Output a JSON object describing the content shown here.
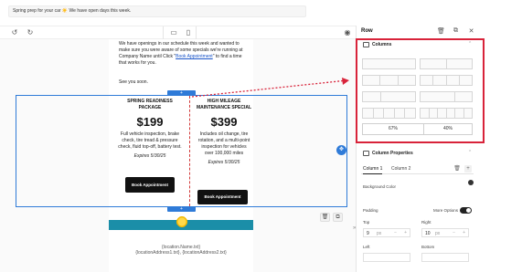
{
  "subject": {
    "text": "Spring prep for your car ☀️ We have open days this week."
  },
  "toolbar": {
    "undo": "↺",
    "redo": "↻",
    "desktop": "▭",
    "mobile": "▯",
    "preview": "◉"
  },
  "email": {
    "intro": "We have openings in our schedule this week and wanted to make sure you were aware of some specials we're running at",
    "company": "Company Name",
    "until": "until",
    "click": "Click \"",
    "link": "Book Appointment",
    "after_link": "\" to find a time that works for you.",
    "closing": "See you soon.",
    "columns": [
      {
        "title": "SPRING READINESS PACKAGE",
        "price": "$199",
        "desc": "Full vehicle inspection, brake check, tire tread & pressure check, fluid top-off, battery test.",
        "expires": "Expires 5/30/25",
        "button": "Book Appointment"
      },
      {
        "title": "HIGH MILEAGE MAINTENANCE SPECIAL",
        "price": "$399",
        "desc": "Includes oil change, tire rotation, and a multi-point inspection for vehicles over 100,000 miles",
        "expires": "Expires 5/30/25",
        "button": "Book Appointment"
      }
    ],
    "footer_line1": "{location.Name.txt}",
    "footer_line2": "{locationAddress1.txt}, {locationAddress2.txt}"
  },
  "panel": {
    "title": "Row",
    "columns_section": "Columns",
    "ratio_left": "67%",
    "ratio_right": "40%",
    "properties_section": "Column Properties",
    "tabs": [
      "Column 1",
      "Column 2"
    ],
    "background_color_label": "Background Color",
    "padding_label": "Padding",
    "more_options_label": "More Options",
    "top_label": "Top",
    "right_label": "Right",
    "left_label": "Left",
    "bottom_label": "Bottom",
    "top_value": "9",
    "right_value": "10",
    "unit": "px"
  },
  "colors": {
    "accent": "#2f7bd8",
    "highlight": "#d8233a",
    "band": "#1b8ea8"
  }
}
